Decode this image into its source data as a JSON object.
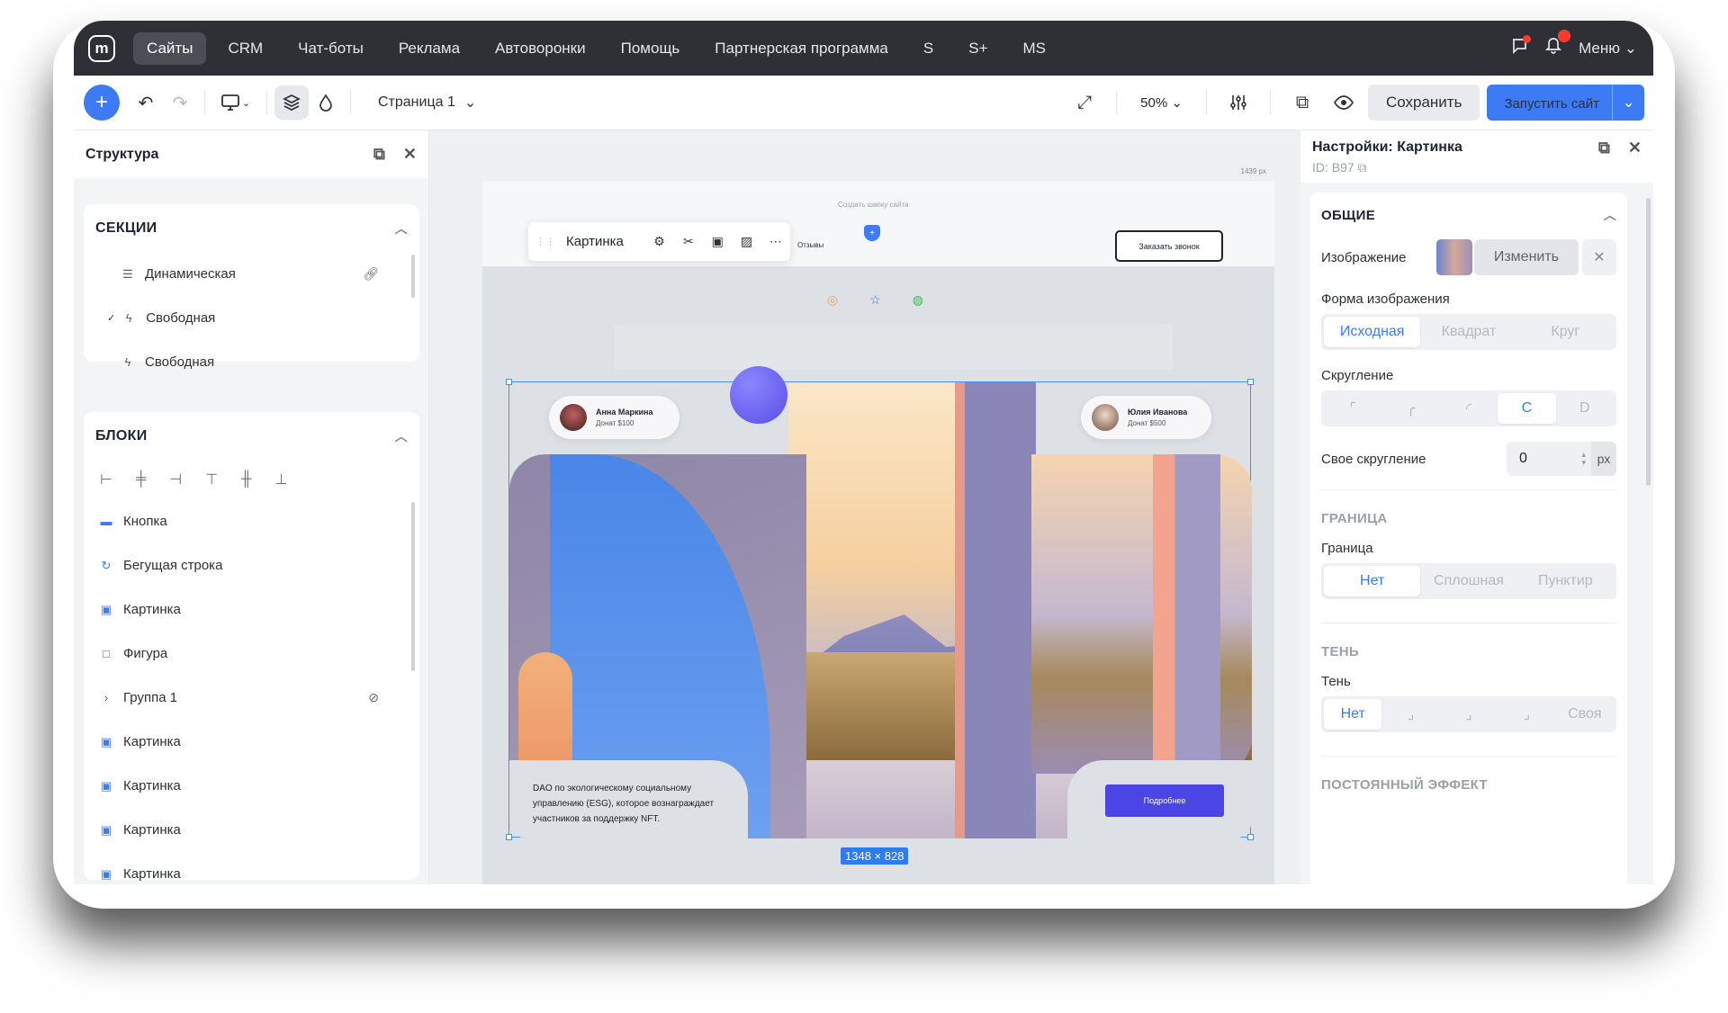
{
  "nav": {
    "logo": "m",
    "items": [
      {
        "label": "Сайты",
        "active": true
      },
      {
        "label": "CRM"
      },
      {
        "label": "Чат-боты"
      },
      {
        "label": "Реклама"
      },
      {
        "label": "Автоворонки"
      },
      {
        "label": "Помощь"
      },
      {
        "label": "Партнерская программа"
      },
      {
        "label": "S"
      },
      {
        "label": "S+"
      },
      {
        "label": "MS"
      }
    ],
    "menu_label": "Меню"
  },
  "toolbar": {
    "page_label": "Страница 1",
    "zoom": "50%",
    "save_label": "Сохранить",
    "launch_label": "Запустить сайт"
  },
  "structure": {
    "title": "Структура",
    "sections_title": "СЕКЦИИ",
    "sections": [
      {
        "label": "Динамическая"
      },
      {
        "label": "Свободная",
        "checked": true
      },
      {
        "label": "Свободная"
      }
    ],
    "blocks_title": "БЛОКИ",
    "blocks": [
      {
        "label": "Кнопка"
      },
      {
        "label": "Бегущая строка"
      },
      {
        "label": "Картинка"
      },
      {
        "label": "Фигура"
      },
      {
        "label": "Группа 1"
      },
      {
        "label": "Картинка"
      },
      {
        "label": "Картинка"
      },
      {
        "label": "Картинка"
      },
      {
        "label": "Картинка"
      }
    ]
  },
  "canvas": {
    "header_label": "Создать шапку сайта",
    "width_tag": "1439 px",
    "reviews_link": "Отзывы",
    "call_button": "Заказать звонок",
    "floatbar_label": "Картинка",
    "dimensions": "1348 × 828",
    "donor1_name": "Анна Маркина",
    "donor1_amount": "Донат $100",
    "donor2_name": "Юлия Иванова",
    "donor2_amount": "Донат $500",
    "description": "DAO по экологическому социальному управлению (ESG), которое вознаграждает участников за поддержку NFT.",
    "more_button": "Подробнее"
  },
  "settings": {
    "title": "Настройки: Картинка",
    "id": "ID: B97",
    "general_title": "ОБЩИЕ",
    "image_label": "Изображение",
    "change_button": "Изменить",
    "shape_label": "Форма изображения",
    "shape_options": [
      "Исходная",
      "Квадрат",
      "Круг"
    ],
    "rounding_label": "Скругление",
    "rounding_options": [
      "",
      "",
      "",
      "C",
      "D"
    ],
    "custom_rounding_label": "Свое скругление",
    "custom_rounding_value": "0",
    "custom_rounding_unit": "px",
    "border_title": "ГРАНИЦА",
    "border_label": "Граница",
    "border_options": [
      "Нет",
      "Сплошная",
      "Пунктир"
    ],
    "shadow_title": "ТЕНЬ",
    "shadow_label": "Тень",
    "shadow_options": [
      "Нет",
      "",
      "",
      "",
      "Своя"
    ],
    "effect_title": "ПОСТОЯННЫЙ ЭФФЕКТ"
  }
}
